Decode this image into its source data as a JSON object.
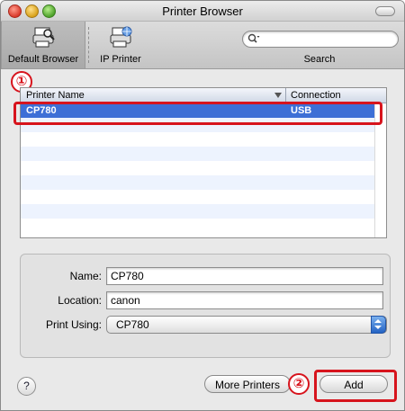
{
  "window": {
    "title": "Printer Browser"
  },
  "toolbar": {
    "default_browser_label": "Default Browser",
    "ip_printer_label": "IP Printer",
    "search_label": "Search",
    "search_placeholder": ""
  },
  "annotations": {
    "step1": "①",
    "step2": "②"
  },
  "table": {
    "columns": [
      "Printer Name",
      "Connection"
    ],
    "rows": [
      {
        "name": "CP780",
        "connection": "USB",
        "selected": true
      }
    ]
  },
  "details": {
    "name_label": "Name:",
    "name_value": "CP780",
    "location_label": "Location:",
    "location_value": "canon",
    "print_using_label": "Print Using:",
    "print_using_value": "CP780"
  },
  "buttons": {
    "help": "?",
    "more_printers": "More Printers",
    "add": "Add"
  },
  "colors": {
    "selection": "#3d6fd6",
    "annotation_red": "#d7141d"
  }
}
